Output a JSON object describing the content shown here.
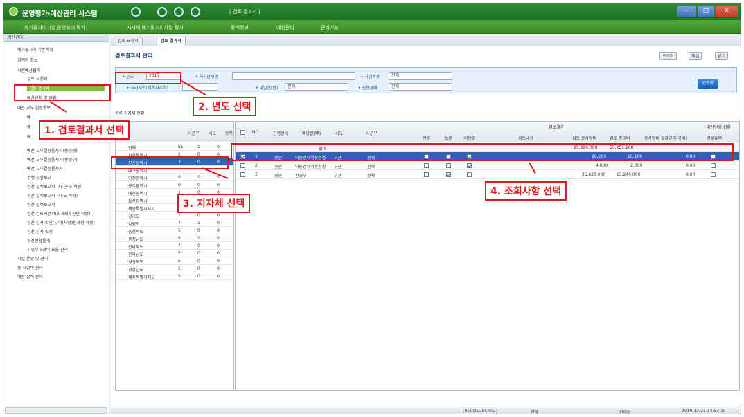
{
  "window": {
    "title": "운영평가·예산관리 시스템",
    "doc_title": "[ 검토 결과서 ]",
    "controls": [
      "–",
      "□",
      "X"
    ]
  },
  "menu": [
    "폐기물처리시설 운영상태 평가",
    "지자체 폐기물처리사업 평가",
    "통계정보",
    "예산관리",
    "관리기능"
  ],
  "sidebar": {
    "header": "예산관리",
    "items": [
      "폐기물처리 기본계획",
      "회계의 정보",
      "사전예산협의",
      "검토 요청서",
      "검토 결과서",
      "예산신청 및 현황",
      "예산 교부·결정통보",
      "예",
      "예",
      "예",
      "예산 교부결정통지서(환경청)",
      "예산 교부결정통지서(환경부)",
      "예산 교부결정통지서",
      "수행 상황보고",
      "정산 실적보고서 (시·군·구 작성)",
      "정산 실적보고서 (시·도 작성)",
      "정산 실적보고서",
      "정산 검토의견서(회계회추진단 작성)",
      "정산 심사·확인(유역(지방)환경청 작성)",
      "정산 심사·확정",
      "정산현황통계",
      "사업부대경비 요율 관리",
      "시설 운영 및 관리",
      "총 사업비 관리",
      "예산 실적 관리"
    ]
  },
  "tabs": [
    "검토 요청서",
    "검토 결과서"
  ],
  "panel": {
    "title": "검토결과서 관리",
    "buttons": [
      "초기화",
      "엑셀",
      "닫기"
    ]
  },
  "search": {
    "year_label": "• 년도",
    "year_value": "2017",
    "project_label": "• 처리단위명",
    "project_value": "",
    "type_label": "• 사업종류",
    "type_value": "전체",
    "region_label": "• 처리지역(회계처주역)",
    "region_value": "",
    "facility_label": "• 파일관(법)",
    "facility_value": "전체",
    "status_label": "• 진행상태",
    "status_value": "전체",
    "search_button": "Q조회"
  },
  "left_grid": {
    "title": "등록 지자체 현황",
    "headers": [
      "시군구",
      "시도",
      "등록"
    ],
    "rows": [
      {
        "name": "전체",
        "a": "61",
        "b": "1",
        "c": "0"
      },
      {
        "name": "서울특별시",
        "a": "6",
        "b": "0",
        "c": "0"
      },
      {
        "name": "부산광역시",
        "a": "3",
        "b": "0",
        "c": "0"
      },
      {
        "name": "대구광역시",
        "a": "",
        "b": "",
        "c": ""
      },
      {
        "name": "인천광역시",
        "a": "0",
        "b": "0",
        "c": "0"
      },
      {
        "name": "광주광역시",
        "a": "0",
        "b": "0",
        "c": "0"
      },
      {
        "name": "대전광역시",
        "a": "1",
        "b": "0",
        "c": "0"
      },
      {
        "name": "울산광역시",
        "a": "0",
        "b": "0",
        "c": "0"
      },
      {
        "name": "세종특별자치시",
        "a": "2",
        "b": "0",
        "c": "0"
      },
      {
        "name": "경기도",
        "a": "2",
        "b": "0",
        "c": "0"
      },
      {
        "name": "강원도",
        "a": "7",
        "b": "1",
        "c": "0"
      },
      {
        "name": "충청북도",
        "a": "5",
        "b": "0",
        "c": "0"
      },
      {
        "name": "충청남도",
        "a": "6",
        "b": "0",
        "c": "0"
      },
      {
        "name": "전라북도",
        "a": "7",
        "b": "0",
        "c": "0"
      },
      {
        "name": "전라남도",
        "a": "5",
        "b": "0",
        "c": "0"
      },
      {
        "name": "경상북도",
        "a": "5",
        "b": "0",
        "c": "0"
      },
      {
        "name": "경상남도",
        "a": "5",
        "b": "0",
        "c": "0"
      },
      {
        "name": "제주특별자치도",
        "a": "5",
        "b": "0",
        "c": "0"
      }
    ]
  },
  "right_grid": {
    "group_header": "검토결과",
    "group_header2": "예산반영 현황",
    "headers": [
      "NO",
      "진행상태",
      "폐양합(甲)",
      "시도",
      "시군구",
      "반영",
      "보완",
      "미반영",
      "검토내용",
      "검토 총사업비",
      "검토 총국비",
      "총사업비 절감금액(국비)",
      "반영유무"
    ],
    "total_label": "합계",
    "total_values": [
      "25,920,000",
      "15,251,160"
    ],
    "rows": [
      {
        "no": "1",
        "status": "승인",
        "name": "낙동강유역환경청",
        "sido": "부산",
        "sigungu": "전체",
        "amount1": "20,200",
        "amount2": "10,100",
        "saving": "0.00"
      },
      {
        "no": "2",
        "status": "승인",
        "name": "낙동강유역환경청",
        "sido": "부산",
        "sigungu": "전체",
        "amount1": "4,000",
        "amount2": "2,000",
        "saving": "0.00"
      },
      {
        "no": "3",
        "status": "승인",
        "name": "환경부",
        "sido": "부산",
        "sigungu": "전체",
        "amount1": "25,620,000",
        "amount2": "15,249,000",
        "saving": "0.00"
      }
    ]
  },
  "status": {
    "session": "[RECOSUBCN02]",
    "lang": "한국",
    "user": "관리자",
    "datetime": "2019-12-21 14:53:15"
  },
  "annotations": {
    "step1": "1. 검토결과서 선택",
    "step2": "2. 년도 선택",
    "step3": "3. 지자체 선택",
    "step4": "4. 조회사항 선택"
  },
  "colors": {
    "title_green": "#1f6e22",
    "highlight_red": "#e0181c",
    "selection_blue": "#2c63b5"
  }
}
